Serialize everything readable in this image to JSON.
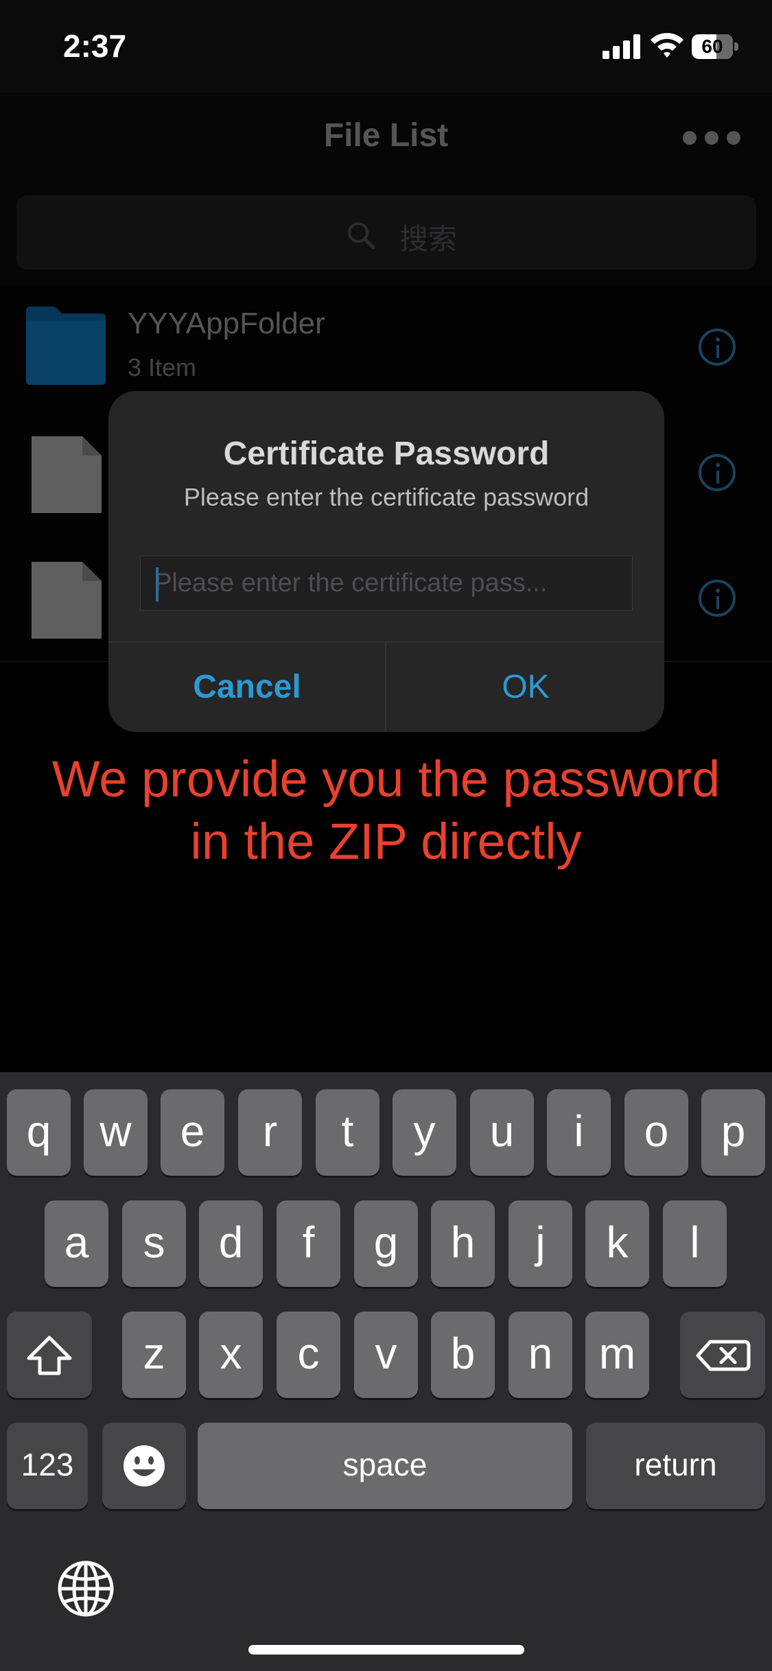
{
  "status_bar": {
    "time": "2:37",
    "battery": "60"
  },
  "nav": {
    "title": "File List"
  },
  "search": {
    "placeholder": "搜索"
  },
  "files": [
    {
      "name": "YYYAppFolder",
      "count": "3 Item",
      "icon": "folder-icon"
    },
    {
      "name": "",
      "count": "",
      "icon": "document-icon"
    },
    {
      "name": "",
      "count": "",
      "icon": "document-icon"
    }
  ],
  "dialog": {
    "title": "Certificate Password",
    "message": "Please enter the certificate password",
    "input_placeholder": "Please enter the certificate pass...",
    "input_value": "",
    "cancel_label": "Cancel",
    "ok_label": "OK"
  },
  "caption": {
    "line1": "We provide you the password",
    "line2": "in the ZIP directly"
  },
  "keyboard": {
    "row1": [
      "q",
      "w",
      "e",
      "r",
      "t",
      "y",
      "u",
      "i",
      "o",
      "p"
    ],
    "row2": [
      "a",
      "s",
      "d",
      "f",
      "g",
      "h",
      "j",
      "k",
      "l"
    ],
    "row3": [
      "z",
      "x",
      "c",
      "v",
      "b",
      "n",
      "m"
    ],
    "numbers_label": "123",
    "space_label": "space",
    "return_label": "return"
  },
  "colors": {
    "accent": "#2d99d2",
    "caption_red": "#e8412f",
    "folder_blue": "#0f6aa6",
    "background": "#000000"
  }
}
